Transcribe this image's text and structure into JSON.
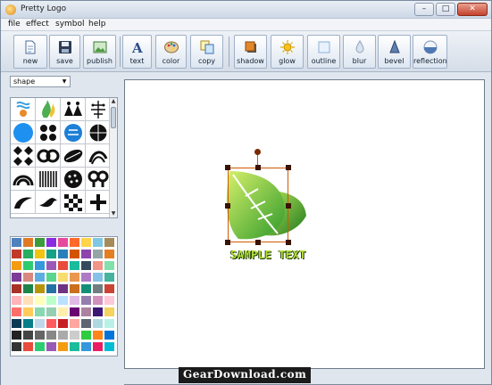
{
  "window": {
    "title": "Pretty Logo"
  },
  "window_controls": [
    "minimize",
    "maximize",
    "close"
  ],
  "menu": [
    {
      "label": "file"
    },
    {
      "label": "effect"
    },
    {
      "label": "symbol"
    },
    {
      "label": "help"
    }
  ],
  "toolbar": [
    {
      "label": "new",
      "icon": "new-document-icon"
    },
    {
      "label": "save",
      "icon": "floppy-disk-icon"
    },
    {
      "label": "publish",
      "icon": "publish-image-icon"
    },
    {
      "label": "text",
      "icon": "text-a-icon"
    },
    {
      "label": "color",
      "icon": "palette-icon"
    },
    {
      "label": "copy",
      "icon": "copy-icon"
    },
    {
      "label": "shadow",
      "icon": "shadow-icon"
    },
    {
      "label": "glow",
      "icon": "glow-sun-icon"
    },
    {
      "label": "outline",
      "icon": "outline-icon"
    },
    {
      "label": "blur",
      "icon": "blur-drop-icon"
    },
    {
      "label": "bevel",
      "icon": "bevel-cone-icon"
    },
    {
      "label": "reflection",
      "icon": "reflection-icon"
    }
  ],
  "shape_select": {
    "value": "shape"
  },
  "canvas": {
    "sample_text": "SAMPLE TEXT"
  },
  "watermark": "GearDownload.com",
  "palette_colors": [
    "#4f81bd",
    "#e07b24",
    "#3c9c3c",
    "#8a2be2",
    "#e64a9c",
    "#ff6a2a",
    "#ffd34a",
    "#7ec8e3",
    "#a58a5a",
    "#c0392b",
    "#27ae60",
    "#f1c40f",
    "#16a085",
    "#2980b9",
    "#d35400",
    "#8e44ad",
    "#95a5a6",
    "#e67e22",
    "#f39c12",
    "#2ecc71",
    "#3498db",
    "#9b59b6",
    "#e74c3c",
    "#1abc9c",
    "#34495e",
    "#f1948a",
    "#82e0aa",
    "#7d3c98",
    "#d98880",
    "#5dade2",
    "#58d68d",
    "#f7dc6f",
    "#eb984e",
    "#af7ac5",
    "#85c1e9",
    "#45b39d",
    "#a93226",
    "#1e8449",
    "#b7950b",
    "#2471a3",
    "#6c3483",
    "#ca6f1e",
    "#148f77",
    "#717d7e",
    "#cb4335",
    "#ffb3ba",
    "#ffdfba",
    "#ffffba",
    "#baffc9",
    "#bae1ff",
    "#e0bbe4",
    "#957dad",
    "#d291bc",
    "#fec8d8",
    "#ff6f69",
    "#ffcc5c",
    "#88d8b0",
    "#96ceb4",
    "#ffeead",
    "#6a0572",
    "#ab83a1",
    "#3c1874",
    "#f4d35e",
    "#0b3954",
    "#087e8b",
    "#bfd7ea",
    "#ff5a5f",
    "#c81d25",
    "#ffa69e",
    "#5e6472",
    "#aed9e0",
    "#b8f2e6",
    "#222222",
    "#444444",
    "#666666",
    "#888888",
    "#aaaaaa",
    "#cccccc",
    "#2ecc40",
    "#ff851b",
    "#0074d9",
    "#333333",
    "#e74c3c",
    "#2ecc71",
    "#9b59b6",
    "#f39c12",
    "#1abc9c",
    "#3498db",
    "#e91e63",
    "#00bcd4"
  ]
}
